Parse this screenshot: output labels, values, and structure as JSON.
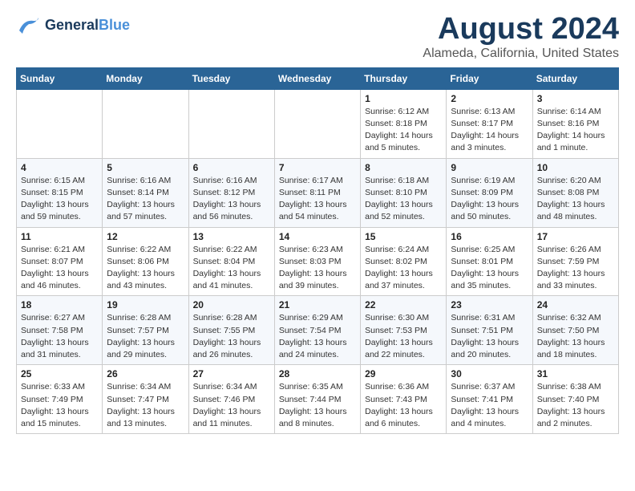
{
  "header": {
    "logo_general": "General",
    "logo_blue": "Blue",
    "title": "August 2024",
    "subtitle": "Alameda, California, United States"
  },
  "days_of_week": [
    "Sunday",
    "Monday",
    "Tuesday",
    "Wednesday",
    "Thursday",
    "Friday",
    "Saturday"
  ],
  "weeks": [
    [
      {
        "day": "",
        "info": ""
      },
      {
        "day": "",
        "info": ""
      },
      {
        "day": "",
        "info": ""
      },
      {
        "day": "",
        "info": ""
      },
      {
        "day": "1",
        "info": "Sunrise: 6:12 AM\nSunset: 8:18 PM\nDaylight: 14 hours\nand 5 minutes."
      },
      {
        "day": "2",
        "info": "Sunrise: 6:13 AM\nSunset: 8:17 PM\nDaylight: 14 hours\nand 3 minutes."
      },
      {
        "day": "3",
        "info": "Sunrise: 6:14 AM\nSunset: 8:16 PM\nDaylight: 14 hours\nand 1 minute."
      }
    ],
    [
      {
        "day": "4",
        "info": "Sunrise: 6:15 AM\nSunset: 8:15 PM\nDaylight: 13 hours\nand 59 minutes."
      },
      {
        "day": "5",
        "info": "Sunrise: 6:16 AM\nSunset: 8:14 PM\nDaylight: 13 hours\nand 57 minutes."
      },
      {
        "day": "6",
        "info": "Sunrise: 6:16 AM\nSunset: 8:12 PM\nDaylight: 13 hours\nand 56 minutes."
      },
      {
        "day": "7",
        "info": "Sunrise: 6:17 AM\nSunset: 8:11 PM\nDaylight: 13 hours\nand 54 minutes."
      },
      {
        "day": "8",
        "info": "Sunrise: 6:18 AM\nSunset: 8:10 PM\nDaylight: 13 hours\nand 52 minutes."
      },
      {
        "day": "9",
        "info": "Sunrise: 6:19 AM\nSunset: 8:09 PM\nDaylight: 13 hours\nand 50 minutes."
      },
      {
        "day": "10",
        "info": "Sunrise: 6:20 AM\nSunset: 8:08 PM\nDaylight: 13 hours\nand 48 minutes."
      }
    ],
    [
      {
        "day": "11",
        "info": "Sunrise: 6:21 AM\nSunset: 8:07 PM\nDaylight: 13 hours\nand 46 minutes."
      },
      {
        "day": "12",
        "info": "Sunrise: 6:22 AM\nSunset: 8:06 PM\nDaylight: 13 hours\nand 43 minutes."
      },
      {
        "day": "13",
        "info": "Sunrise: 6:22 AM\nSunset: 8:04 PM\nDaylight: 13 hours\nand 41 minutes."
      },
      {
        "day": "14",
        "info": "Sunrise: 6:23 AM\nSunset: 8:03 PM\nDaylight: 13 hours\nand 39 minutes."
      },
      {
        "day": "15",
        "info": "Sunrise: 6:24 AM\nSunset: 8:02 PM\nDaylight: 13 hours\nand 37 minutes."
      },
      {
        "day": "16",
        "info": "Sunrise: 6:25 AM\nSunset: 8:01 PM\nDaylight: 13 hours\nand 35 minutes."
      },
      {
        "day": "17",
        "info": "Sunrise: 6:26 AM\nSunset: 7:59 PM\nDaylight: 13 hours\nand 33 minutes."
      }
    ],
    [
      {
        "day": "18",
        "info": "Sunrise: 6:27 AM\nSunset: 7:58 PM\nDaylight: 13 hours\nand 31 minutes."
      },
      {
        "day": "19",
        "info": "Sunrise: 6:28 AM\nSunset: 7:57 PM\nDaylight: 13 hours\nand 29 minutes."
      },
      {
        "day": "20",
        "info": "Sunrise: 6:28 AM\nSunset: 7:55 PM\nDaylight: 13 hours\nand 26 minutes."
      },
      {
        "day": "21",
        "info": "Sunrise: 6:29 AM\nSunset: 7:54 PM\nDaylight: 13 hours\nand 24 minutes."
      },
      {
        "day": "22",
        "info": "Sunrise: 6:30 AM\nSunset: 7:53 PM\nDaylight: 13 hours\nand 22 minutes."
      },
      {
        "day": "23",
        "info": "Sunrise: 6:31 AM\nSunset: 7:51 PM\nDaylight: 13 hours\nand 20 minutes."
      },
      {
        "day": "24",
        "info": "Sunrise: 6:32 AM\nSunset: 7:50 PM\nDaylight: 13 hours\nand 18 minutes."
      }
    ],
    [
      {
        "day": "25",
        "info": "Sunrise: 6:33 AM\nSunset: 7:49 PM\nDaylight: 13 hours\nand 15 minutes."
      },
      {
        "day": "26",
        "info": "Sunrise: 6:34 AM\nSunset: 7:47 PM\nDaylight: 13 hours\nand 13 minutes."
      },
      {
        "day": "27",
        "info": "Sunrise: 6:34 AM\nSunset: 7:46 PM\nDaylight: 13 hours\nand 11 minutes."
      },
      {
        "day": "28",
        "info": "Sunrise: 6:35 AM\nSunset: 7:44 PM\nDaylight: 13 hours\nand 8 minutes."
      },
      {
        "day": "29",
        "info": "Sunrise: 6:36 AM\nSunset: 7:43 PM\nDaylight: 13 hours\nand 6 minutes."
      },
      {
        "day": "30",
        "info": "Sunrise: 6:37 AM\nSunset: 7:41 PM\nDaylight: 13 hours\nand 4 minutes."
      },
      {
        "day": "31",
        "info": "Sunrise: 6:38 AM\nSunset: 7:40 PM\nDaylight: 13 hours\nand 2 minutes."
      }
    ]
  ]
}
